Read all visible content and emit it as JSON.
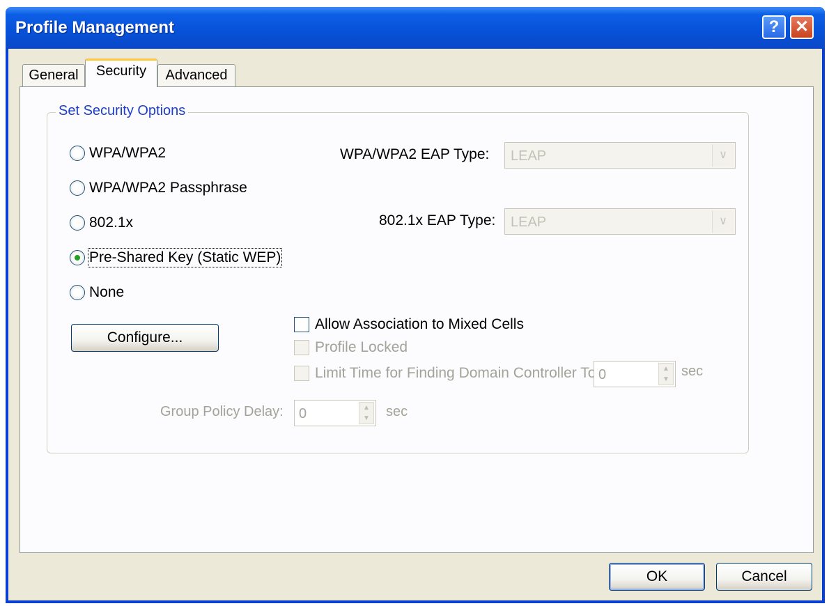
{
  "window": {
    "title": "Profile Management",
    "help_label": "?",
    "close_label": "✕"
  },
  "tabs": [
    {
      "label": "General"
    },
    {
      "label": "Security"
    },
    {
      "label": "Advanced"
    }
  ],
  "group": {
    "legend": "Set Security Options"
  },
  "radios": {
    "wpa": "WPA/WPA2",
    "wpa_passphrase": "WPA/WPA2 Passphrase",
    "dot1x": "802.1x",
    "psk": "Pre-Shared Key (Static WEP)",
    "none": "None",
    "selected": "Pre-Shared Key (Static WEP)"
  },
  "eap": {
    "wpa_label": "WPA/WPA2 EAP Type:",
    "wpa_value": "LEAP",
    "dot1x_label": "802.1x EAP Type:",
    "dot1x_value": "LEAP"
  },
  "configure_label": "Configure...",
  "checks": {
    "mixed_cells": "Allow Association to Mixed Cells",
    "profile_locked": "Profile Locked",
    "limit_time": "Limit Time for Finding Domain Controller To:"
  },
  "limit_time": {
    "value": "0",
    "unit": "sec"
  },
  "group_policy": {
    "label": "Group Policy Delay:",
    "value": "0",
    "unit": "sec"
  },
  "buttons": {
    "ok": "OK",
    "cancel": "Cancel"
  }
}
